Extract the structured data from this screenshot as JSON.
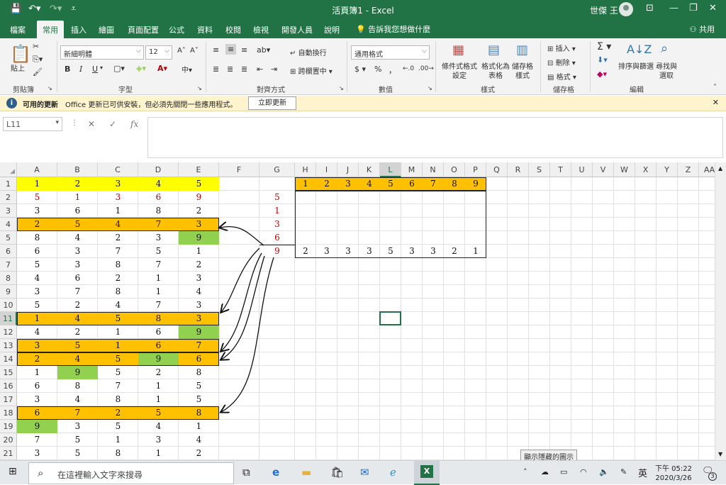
{
  "titlebar": {
    "title": "活頁簿1 - Excel",
    "user": "世傑 王",
    "icons": [
      "save-icon",
      "undo-icon",
      "redo-icon",
      "customize-icon",
      "ribbon-display-icon",
      "minimize-icon",
      "restore-icon",
      "close-icon"
    ]
  },
  "tabs": [
    "檔案",
    "常用",
    "插入",
    "繪圖",
    "頁面配置",
    "公式",
    "資料",
    "校閱",
    "檢視",
    "開發人員",
    "說明"
  ],
  "active_tab": "常用",
  "tell_me": "告訴我您想做什麼",
  "share": "共用",
  "ribbon": {
    "clipboard": {
      "paste": "貼上",
      "label": "剪貼簿"
    },
    "font": {
      "name": "新細明體",
      "size": "12",
      "label": "字型",
      "bold": "B",
      "italic": "I",
      "underline": "U"
    },
    "alignment": {
      "wrap": "自動換行",
      "merge": "跨欄置中",
      "label": "對齊方式"
    },
    "number": {
      "format": "通用格式",
      "currency": "$",
      "percent": "%",
      "comma": "，",
      "label": "數值"
    },
    "styles": {
      "conditional": "條件式格式設定",
      "table": "格式化為表格",
      "cell": "儲存格樣式",
      "label": "樣式"
    },
    "cells": {
      "insert": "插入",
      "delete": "刪除",
      "format": "格式",
      "label": "儲存格"
    },
    "editing": {
      "sort": "排序與篩選",
      "find": "尋找與選取",
      "label": "編輯"
    }
  },
  "update_bar": {
    "title": "可用的更新",
    "message": "Office 更新已可供安裝，但必須先關閉一些應用程式。",
    "button": "立即更新"
  },
  "formula_bar": {
    "name_box": "L11",
    "fx": "fx",
    "cancel": "✕",
    "enter": "✓"
  },
  "sheet": {
    "columns": [
      "A",
      "B",
      "C",
      "D",
      "E",
      "F",
      "G",
      "H",
      "I",
      "J",
      "K",
      "L",
      "M",
      "N",
      "O",
      "P",
      "Q",
      "R",
      "S",
      "T",
      "U",
      "V",
      "W",
      "X",
      "Y",
      "Z",
      "AA"
    ],
    "selected_column": "L",
    "rows": [
      "1",
      "2",
      "3",
      "4",
      "5",
      "6",
      "7",
      "8",
      "9",
      "10",
      "11",
      "12",
      "13",
      "14",
      "15",
      "16",
      "17",
      "18",
      "19",
      "20",
      "21"
    ],
    "selected_row": "11",
    "selected_cell": "L11",
    "grid_A_E": [
      [
        1,
        2,
        3,
        4,
        5
      ],
      [
        5,
        1,
        3,
        6,
        9
      ],
      [
        3,
        6,
        1,
        8,
        2
      ],
      [
        2,
        5,
        4,
        7,
        3
      ],
      [
        8,
        4,
        2,
        3,
        9
      ],
      [
        6,
        3,
        7,
        5,
        1
      ],
      [
        5,
        3,
        8,
        7,
        2
      ],
      [
        4,
        6,
        2,
        1,
        3
      ],
      [
        3,
        7,
        8,
        1,
        4
      ],
      [
        5,
        2,
        4,
        7,
        3
      ],
      [
        1,
        4,
        5,
        8,
        3
      ],
      [
        4,
        2,
        1,
        6,
        9
      ],
      [
        3,
        5,
        1,
        6,
        7
      ],
      [
        2,
        4,
        5,
        9,
        6
      ],
      [
        1,
        9,
        5,
        2,
        8
      ],
      [
        6,
        8,
        7,
        1,
        5
      ],
      [
        3,
        4,
        8,
        1,
        5
      ],
      [
        6,
        7,
        2,
        5,
        8
      ],
      [
        9,
        3,
        5,
        4,
        1
      ],
      [
        7,
        5,
        1,
        3,
        4
      ],
      [
        3,
        5,
        8,
        1,
        2
      ]
    ],
    "red_row": 2,
    "yellow_row": 1,
    "orange_rows": [
      4,
      11,
      13,
      14,
      18
    ],
    "green_cells": [
      [
        5,
        "E"
      ],
      [
        12,
        "E"
      ],
      [
        14,
        "D"
      ],
      [
        15,
        "B"
      ],
      [
        19,
        "A"
      ]
    ],
    "column_G": {
      "2": "5",
      "3": "1",
      "4": "3",
      "5": "6",
      "6": "9"
    },
    "header_H_P": [
      "1",
      "2",
      "3",
      "4",
      "5",
      "6",
      "7",
      "8",
      "9"
    ],
    "counts_H_P": [
      "2",
      "3",
      "3",
      "3",
      "5",
      "3",
      "3",
      "2",
      "1"
    ],
    "colors": {
      "yellow": "#ffff00",
      "orange": "#ffc000",
      "green": "#92d050",
      "red": "#c00000",
      "excel_green": "#217346"
    }
  },
  "tooltip": "顯示隱藏的圖示",
  "taskbar": {
    "search_placeholder": "在這裡輸入文字來搜尋",
    "ime": "英",
    "time": "下午 05:22",
    "date": "2020/3/26",
    "notifications": "3"
  }
}
